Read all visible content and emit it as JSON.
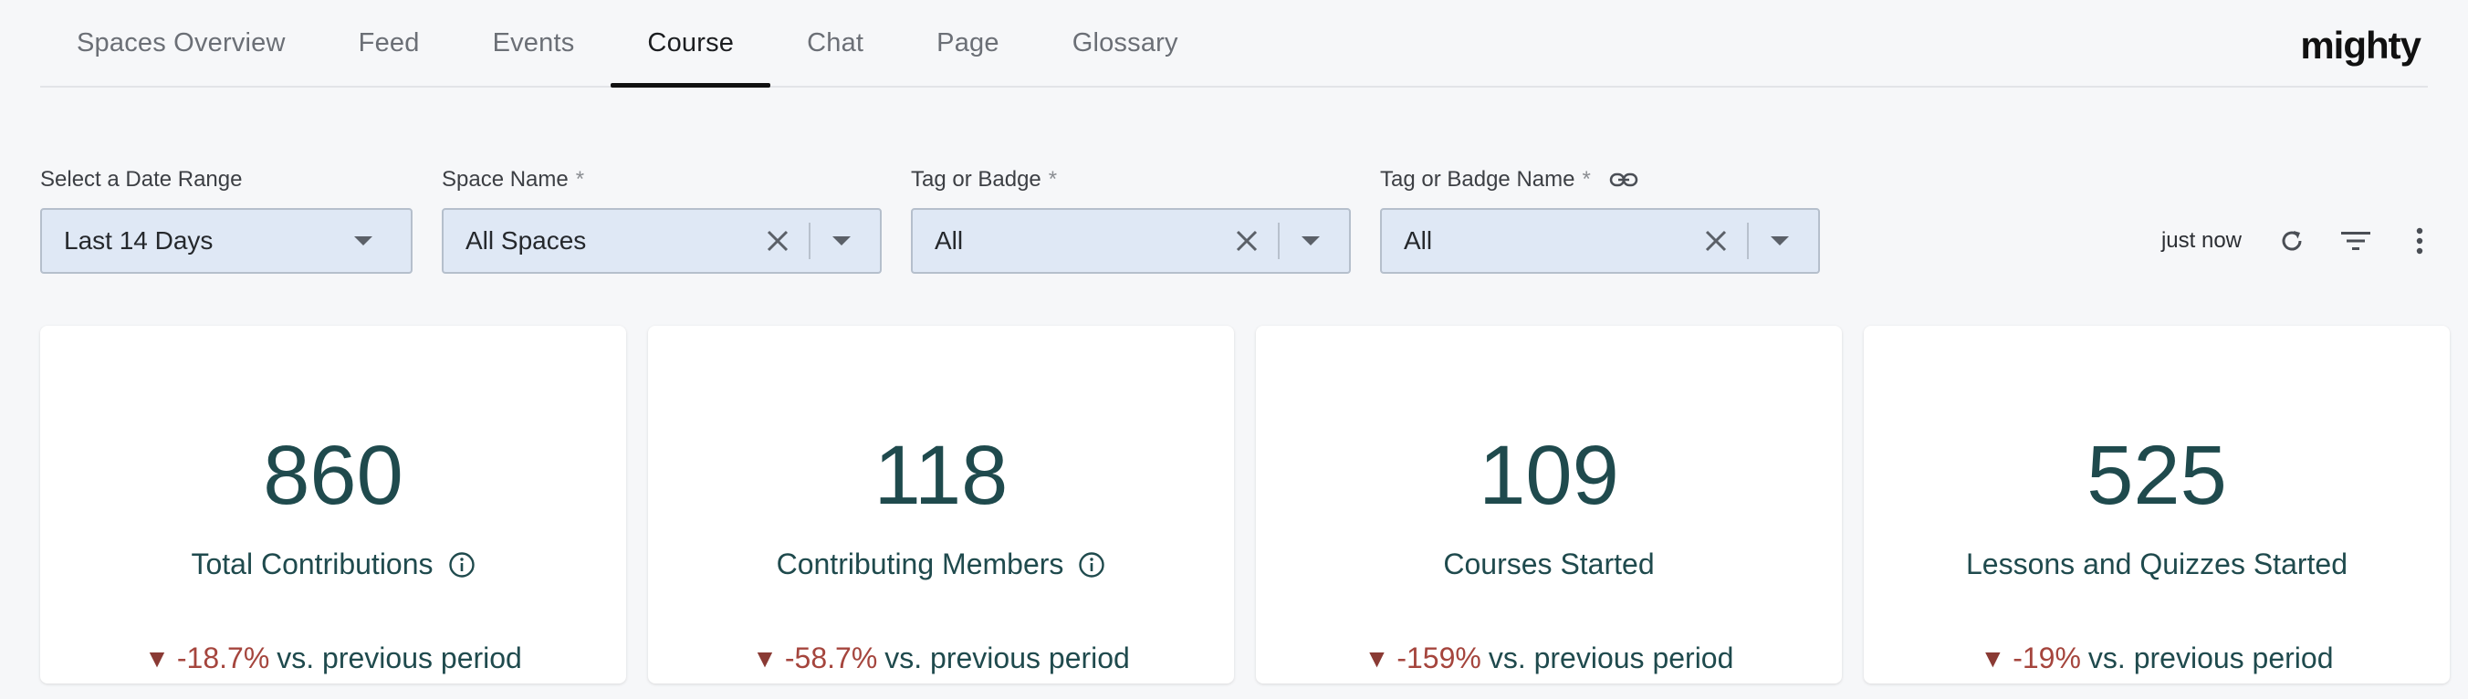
{
  "nav": {
    "tabs": [
      {
        "label": "Spaces Overview"
      },
      {
        "label": "Feed"
      },
      {
        "label": "Events"
      },
      {
        "label": "Course"
      },
      {
        "label": "Chat"
      },
      {
        "label": "Page"
      },
      {
        "label": "Glossary"
      }
    ],
    "active_tab": "Course",
    "brand": "mighty"
  },
  "filters": {
    "date_range": {
      "label": "Select a Date Range",
      "value": "Last 14 Days"
    },
    "space_name": {
      "label": "Space Name",
      "required": "*",
      "value": "All Spaces"
    },
    "tag_or_badge": {
      "label": "Tag or Badge",
      "required": "*",
      "value": "All"
    },
    "tag_or_badge_name": {
      "label": "Tag or Badge Name",
      "required": "*",
      "value": "All"
    }
  },
  "toolbar": {
    "updated": "just now",
    "icons": [
      "refresh-icon",
      "filter-icon",
      "more-vertical-icon"
    ]
  },
  "cards": [
    {
      "value": "860",
      "label": "Total Contributions",
      "has_info": true,
      "change": "-18.7%",
      "suffix": "vs. previous period"
    },
    {
      "value": "118",
      "label": "Contributing Members",
      "has_info": true,
      "change": "-58.7%",
      "suffix": "vs. previous period"
    },
    {
      "value": "109",
      "label": "Courses Started",
      "has_info": false,
      "change": "-159%",
      "suffix": "vs. previous period"
    },
    {
      "value": "525",
      "label": "Lessons and Quizzes Started",
      "has_info": false,
      "change": "-19%",
      "suffix": "vs. previous period"
    }
  ],
  "colors": {
    "accent_text": "#1f4a4d",
    "negative": "#a5453d",
    "select_bg": "#dfe8f5"
  }
}
